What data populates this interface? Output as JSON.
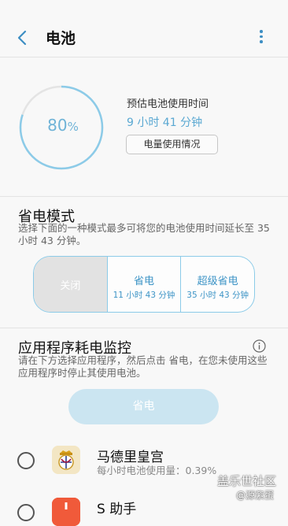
{
  "header": {
    "title": "电池"
  },
  "battery": {
    "percent": "80",
    "percent_unit": "%",
    "estimate_label": "预估电池使用时间",
    "estimate_value": "9 小时 41 分钟",
    "usage_button": "电量使用情况",
    "ring_color": "#8ccbe8",
    "ring_track_color": "#e4e4e4"
  },
  "power_saving": {
    "title": "省电模式",
    "description": "选择下面的一种模式最多可将您的电池使用时间延长至 35 小时 43 分钟。",
    "modes": [
      {
        "name": "关闭",
        "time": ""
      },
      {
        "name": "省电",
        "time": "11 小时 43 分钟"
      },
      {
        "name": "超级省电",
        "time": "35 小时 43 分钟"
      }
    ],
    "selected_mode": "关闭",
    "accent_color": "#3d94c6"
  },
  "app_monitor": {
    "title": "应用程序耗电监控",
    "description": "请在下方选择应用程序，然后点击 省电，在您未使用这些应用程序时停止其使用电池。",
    "save_button": "省电",
    "apps": [
      {
        "name": "马德里皇宫",
        "usage": "每小时电池使用量：0.39%",
        "icon": "real-madrid-crest-icon"
      },
      {
        "name": "S 助手",
        "usage": "",
        "icon": "s-assistant-icon"
      }
    ]
  },
  "watermark": {
    "line1": "盖乐世社区",
    "line2": "@源紫蛋"
  }
}
